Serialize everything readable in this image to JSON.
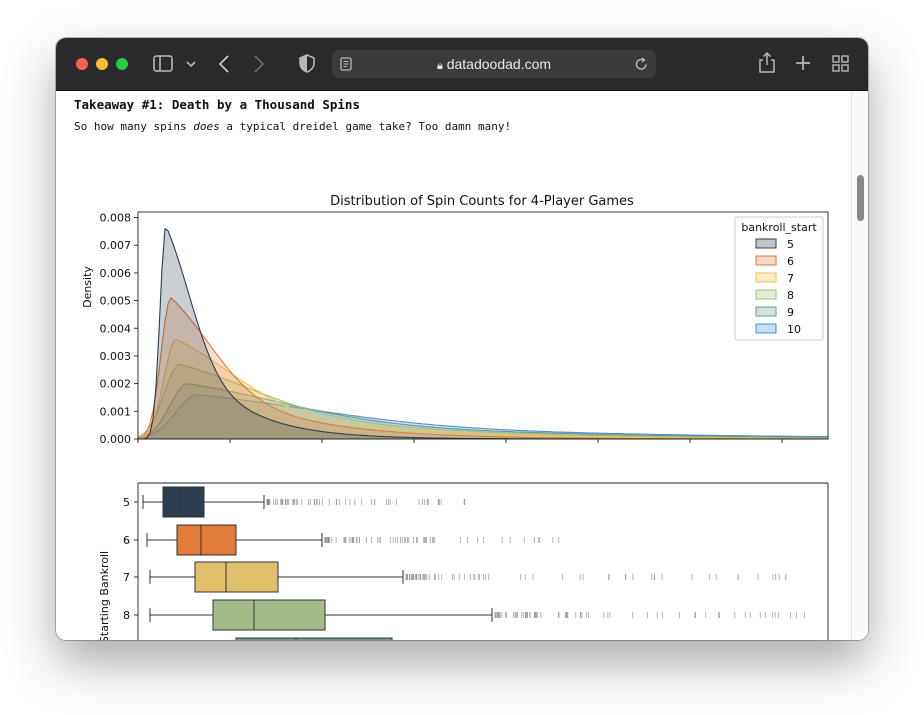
{
  "browser": {
    "url": "datadoodad.com",
    "colors": {
      "close": "#ff5f57",
      "minimize": "#febc2e",
      "zoom": "#28c840"
    },
    "icons": [
      "sidebar-icon",
      "chevron-down-icon",
      "back-icon",
      "forward-icon",
      "shield-icon",
      "reader-icon",
      "lock-icon",
      "reload-icon",
      "share-icon",
      "new-tab-icon",
      "tab-overview-icon"
    ]
  },
  "article": {
    "heading": "Takeaway #1: Death by a Thousand Spins",
    "para_before": "So how many spins ",
    "para_emph": "does",
    "para_after": " a typical dreidel game take? Too damn many!"
  },
  "chart_data": [
    {
      "type": "area",
      "title": "Distribution of Spin Counts for 4-Player Games",
      "xlabel": "",
      "ylabel": "Density",
      "yticks": [
        "0.000",
        "0.001",
        "0.002",
        "0.003",
        "0.004",
        "0.005",
        "0.006",
        "0.007",
        "0.008"
      ],
      "ylim": [
        0,
        0.0082
      ],
      "legend": {
        "title": "bankroll_start",
        "placement": "top-right"
      },
      "series": [
        {
          "name": "5",
          "peak_density": 0.0077,
          "color": "#2c3e50"
        },
        {
          "name": "6",
          "peak_density": 0.0051,
          "color": "#e07b39"
        },
        {
          "name": "7",
          "peak_density": 0.0036,
          "color": "#f2c14e"
        },
        {
          "name": "8",
          "peak_density": 0.0027,
          "color": "#a3bf7f"
        },
        {
          "name": "9",
          "peak_density": 0.002,
          "color": "#6b9a87"
        },
        {
          "name": "10",
          "peak_density": 0.0016,
          "color": "#4a90d9"
        }
      ]
    },
    {
      "type": "box",
      "ylabel": "Starting Bankroll",
      "categories": [
        "5",
        "6",
        "7",
        "8",
        "9"
      ],
      "colors": [
        "#2c3e50",
        "#e07b39",
        "#e0c06a",
        "#a3bb88",
        "#6f9a88",
        "#4a8fd0"
      ]
    }
  ]
}
